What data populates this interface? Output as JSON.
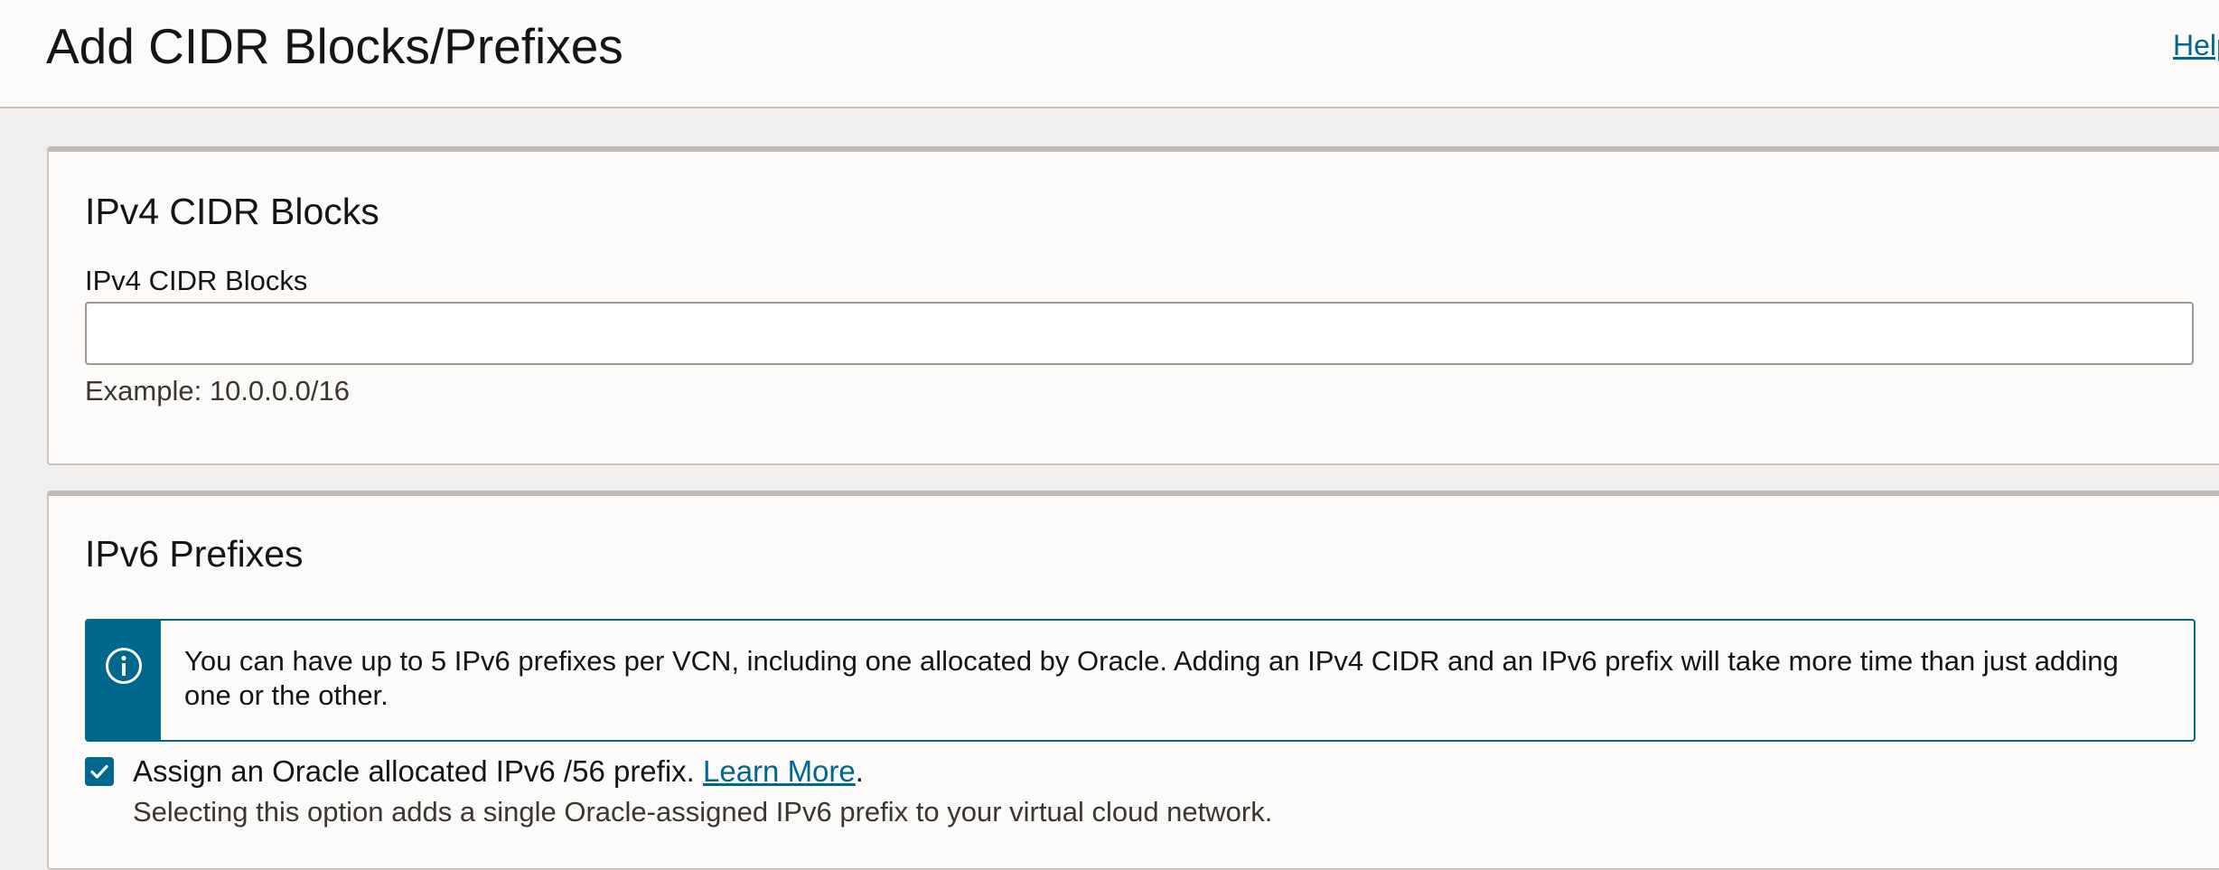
{
  "header": {
    "title": "Add CIDR Blocks/Prefixes",
    "help_label": "Help"
  },
  "ipv4": {
    "section_title": "IPv4 CIDR Blocks",
    "field_label": "IPv4 CIDR Blocks",
    "field_value": "",
    "helper_text": "Example: 10.0.0.0/16"
  },
  "ipv6": {
    "section_title": "IPv6 Prefixes",
    "info_icon": "info-circle-icon",
    "info_text": "You can have up to 5 IPv6 prefixes per VCN, including one allocated by Oracle. Adding an IPv4 CIDR and an IPv6 prefix will take more time than just adding one or the other.",
    "assign_checked": true,
    "assign_label": "Assign an Oracle allocated IPv6 /56 prefix. ",
    "learn_more_label": "Learn More",
    "assign_label_end": ".",
    "assign_helper": "Selecting this option adds a single Oracle-assigned IPv6 prefix to your virtual cloud network."
  },
  "colors": {
    "accent": "#00688c",
    "page_background": "#f1efed",
    "panel_background": "#fcfbfa"
  }
}
